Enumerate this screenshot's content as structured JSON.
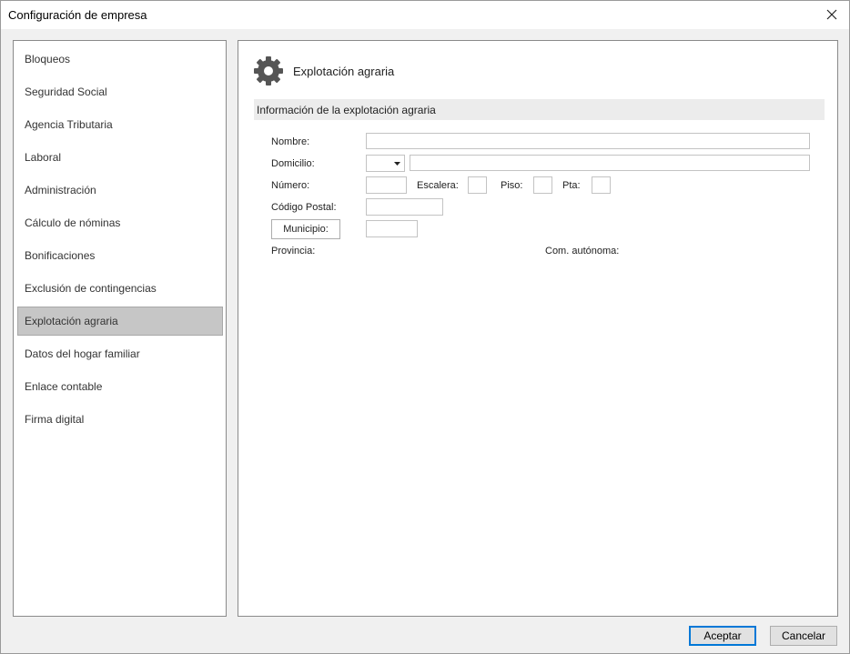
{
  "window": {
    "title": "Configuración de empresa",
    "close_icon": "close-icon"
  },
  "sidebar": {
    "items": [
      {
        "label": "Bloqueos"
      },
      {
        "label": "Seguridad Social"
      },
      {
        "label": "Agencia Tributaria"
      },
      {
        "label": "Laboral"
      },
      {
        "label": "Administración"
      },
      {
        "label": "Cálculo de nóminas"
      },
      {
        "label": "Bonificaciones"
      },
      {
        "label": "Exclusión de contingencias"
      },
      {
        "label": "Explotación agraria",
        "selected": true
      },
      {
        "label": "Datos del hogar familiar"
      },
      {
        "label": "Enlace contable"
      },
      {
        "label": "Firma digital"
      }
    ]
  },
  "main": {
    "icon": "gear-icon",
    "title": "Explotación agraria",
    "section_title": "Información de la explotación agraria",
    "form": {
      "nombre_label": "Nombre:",
      "nombre_value": "",
      "domicilio_label": "Domicilio:",
      "domicilio_type_value": "",
      "domicilio_value": "",
      "numero_label": "Número:",
      "numero_value": "",
      "escalera_label": "Escalera:",
      "escalera_value": "",
      "piso_label": "Piso:",
      "piso_value": "",
      "pta_label": "Pta:",
      "pta_value": "",
      "codigo_postal_label": "Código Postal:",
      "codigo_postal_value": "",
      "municipio_button": "Municipio:",
      "municipio_value": "",
      "provincia_label": "Provincia:",
      "com_autonoma_label": "Com. autónoma:"
    }
  },
  "footer": {
    "accept_label": "Aceptar",
    "cancel_label": "Cancelar"
  },
  "colors": {
    "selected_item": "#c6c6c6",
    "section_bar": "#ececec",
    "default_button_border": "#0078d7"
  }
}
